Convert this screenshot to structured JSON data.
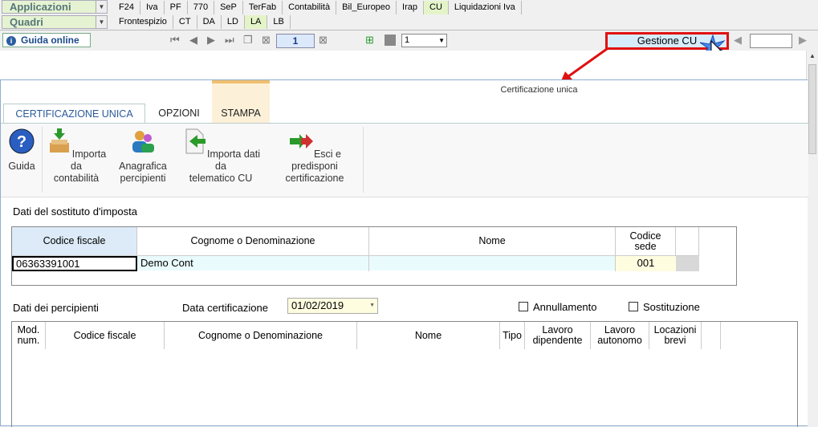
{
  "top": {
    "applicazioni": "Applicazioni",
    "quadri": "Quadri",
    "menu": [
      "F24",
      "Iva",
      "PF",
      "770",
      "SeP",
      "TerFab",
      "Contabilità",
      "Bil_Europeo",
      "Irap",
      "CU",
      "Liquidazioni Iva"
    ],
    "quadri_tabs": [
      "Frontespizio",
      "CT",
      "DA",
      "LD",
      "LA",
      "LB"
    ]
  },
  "toolbar": {
    "guida_online": "Guida online",
    "page": "1",
    "select": "1",
    "gestione": "Gestione CU"
  },
  "form": {
    "title": "Certificazione unica",
    "tabs": [
      "CERTIFICAZIONE UNICA",
      "OPZIONI",
      "STAMPA"
    ],
    "buttons": {
      "guida": "Guida",
      "importa_contabilita": "Importa da\ncontabilità",
      "anagrafica": "Anagrafica\npercipienti",
      "importa_telematico": "Importa dati da\ntelematico CU",
      "esci": "Esci e predisponi\ncertificazione"
    },
    "sostituto": {
      "label": "Dati del sostituto d'imposta",
      "h_cf": "Codice fiscale",
      "h_cogn": "Cognome o Denominazione",
      "h_nome": "Nome",
      "h_sede": "Codice\nsede",
      "cf": "06363391001",
      "cognome": "Demo Cont",
      "nome": "",
      "sede": "001"
    },
    "percipienti": {
      "label": "Dati dei percipienti",
      "data_label": "Data certificazione",
      "data": "01/02/2019",
      "annullamento": "Annullamento",
      "sostituzione": "Sostituzione",
      "headers": [
        "Mod.\nnum.",
        "Codice fiscale",
        "Cognome o Denominazione",
        "Nome",
        "Tipo",
        "Lavoro\ndipendente",
        "Lavoro\nautonomo",
        "Locazioni\nbrevi"
      ]
    }
  },
  "colors": {
    "highlight": "#e01010",
    "accent": "#2e6cb6"
  }
}
